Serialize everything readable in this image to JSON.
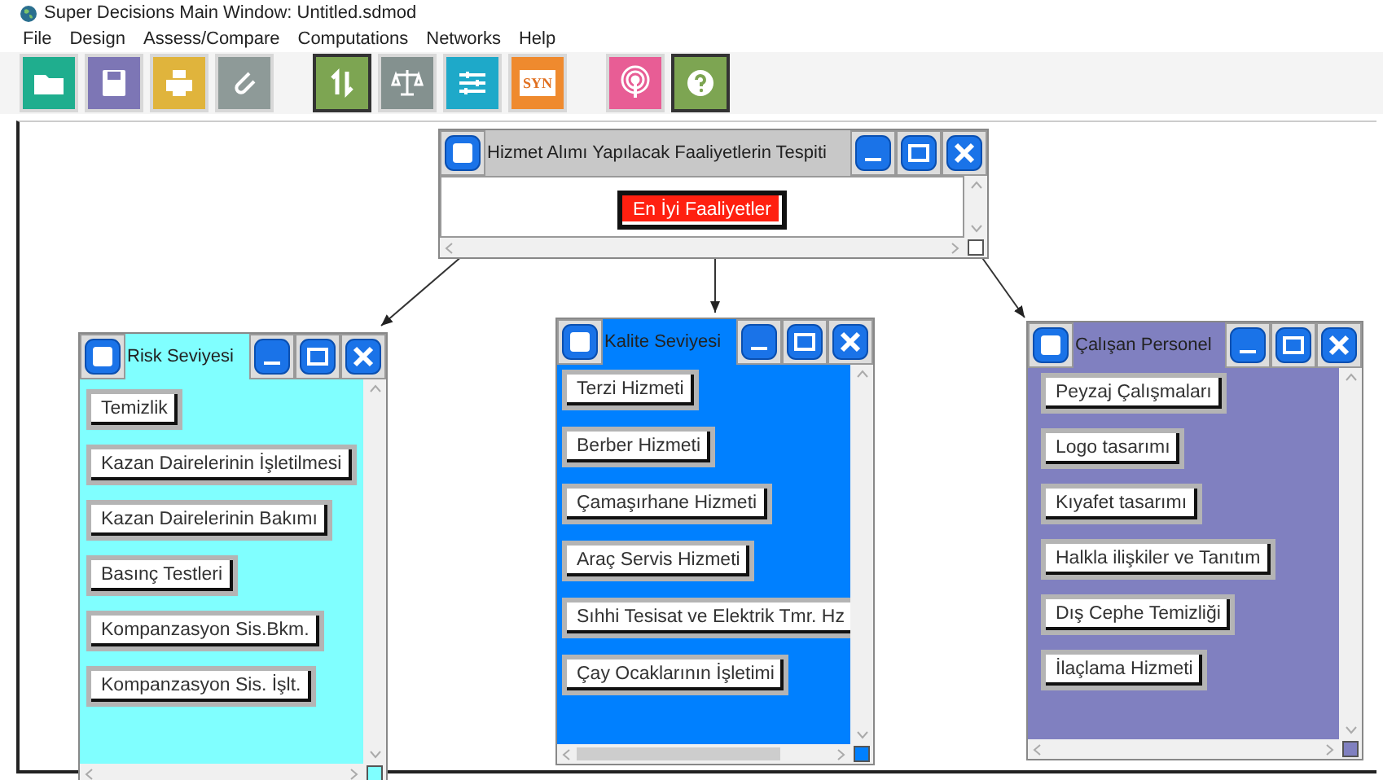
{
  "window": {
    "title": "Super Decisions Main Window: Untitled.sdmod"
  },
  "menu": [
    "File",
    "Design",
    "Assess/Compare",
    "Computations",
    "Networks",
    "Help"
  ],
  "toolbar": [
    {
      "kind": "folder",
      "color": "#1fae8e",
      "pressed": false
    },
    {
      "kind": "save",
      "color": "#7d76b5",
      "pressed": false
    },
    {
      "kind": "print",
      "color": "#e0b43c",
      "pressed": false
    },
    {
      "kind": "clip",
      "color": "#8e9a98",
      "pressed": false
    },
    {
      "kind": "sync",
      "color": "#7da552",
      "pressed": true
    },
    {
      "kind": "scale",
      "color": "#84918f",
      "pressed": false
    },
    {
      "kind": "sliders",
      "color": "#1ea9c9",
      "pressed": false
    },
    {
      "kind": "syn",
      "color": "#ef8a2e",
      "pressed": false,
      "label": "SYN"
    },
    {
      "kind": "antenna",
      "color": "#e85d95",
      "pressed": false
    },
    {
      "kind": "help",
      "color": "#7da552",
      "pressed": true
    }
  ],
  "clusters": [
    {
      "title": "Hizmet Alımı Yapılacak Faaliyetlerin Tespiti",
      "color": "#c8c8c8",
      "nodes": [
        {
          "label": "En İyi Faaliyetler",
          "selected": true
        }
      ]
    },
    {
      "title": "Risk Seviyesi",
      "color": "#80ffff",
      "nodes": [
        {
          "label": "Temizlik",
          "selected": false
        },
        {
          "label": "Kazan Dairelerinin İşletilmesi",
          "selected": false
        },
        {
          "label": "Kazan Dairelerinin Bakımı",
          "selected": false
        },
        {
          "label": "Basınç Testleri",
          "selected": false
        },
        {
          "label": "Kompanzasyon Sis.Bkm.",
          "selected": false
        },
        {
          "label": "Kompanzasyon Sis. İşlt.",
          "selected": false
        }
      ]
    },
    {
      "title": "Kalite Seviyesi",
      "color": "#0080ff",
      "nodes": [
        {
          "label": "Terzi Hizmeti",
          "selected": false
        },
        {
          "label": "Berber Hizmeti",
          "selected": false
        },
        {
          "label": "Çamaşırhane Hizmeti",
          "selected": false
        },
        {
          "label": "Araç Servis Hizmeti",
          "selected": false
        },
        {
          "label": "Sıhhi Tesisat ve Elektrik Tmr. Hz",
          "selected": false
        },
        {
          "label": "Çay Ocaklarının İşletimi",
          "selected": false
        }
      ]
    },
    {
      "title": "Çalışan Personel",
      "color": "#8080c0",
      "nodes": [
        {
          "label": "Peyzaj Çalışmaları",
          "selected": false
        },
        {
          "label": "Logo tasarımı",
          "selected": false
        },
        {
          "label": "Kıyafet tasarımı",
          "selected": false
        },
        {
          "label": "Halkla ilişkiler ve Tanıtım",
          "selected": false
        },
        {
          "label": "Dış Cephe Temizliği",
          "selected": false
        },
        {
          "label": "İlaçlama Hizmeti",
          "selected": false
        }
      ]
    }
  ]
}
